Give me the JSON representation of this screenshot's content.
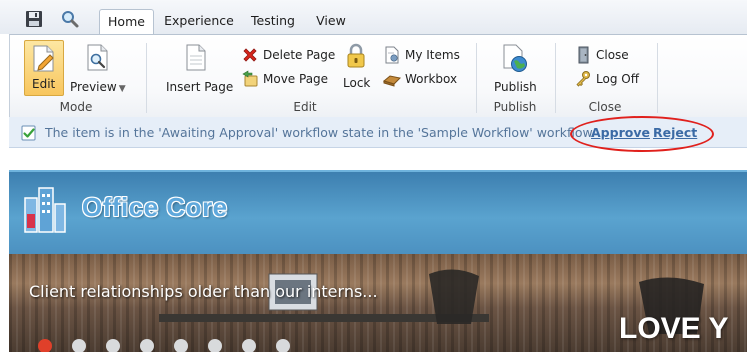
{
  "quick_access": {
    "save_icon": "floppy-disk-icon",
    "search_icon": "magnifier-icon"
  },
  "tabs": [
    {
      "label": "Home",
      "active": true
    },
    {
      "label": "Experience",
      "active": false
    },
    {
      "label": "Testing",
      "active": false
    },
    {
      "label": "View",
      "active": false
    }
  ],
  "ribbon": {
    "mode": {
      "edit_label": "Edit",
      "preview_label": "Preview",
      "group_label": "Mode"
    },
    "edit": {
      "insert_page_label": "Insert Page",
      "delete_page_label": "Delete Page",
      "move_page_label": "Move Page",
      "lock_label": "Lock",
      "my_items_label": "My Items",
      "workbox_label": "Workbox",
      "group_label": "Edit"
    },
    "publish": {
      "publish_label": "Publish",
      "group_label": "Publish"
    },
    "close": {
      "close_label": "Close",
      "log_off_label": "Log Off",
      "group_label": "Close"
    }
  },
  "notification": {
    "message": "The item is in the 'Awaiting Approval' workflow state in the 'Sample Workflow' workflow.",
    "approve_label": "Approve",
    "reject_label": "Reject"
  },
  "site": {
    "logo_text": "Office Core",
    "tagline": "Client relationships older than our interns...",
    "headline": "LOVE Y"
  },
  "colors": {
    "accent_red": "#e0201c",
    "link_blue": "#3b6aa5",
    "header_blue": "#4b90c0"
  }
}
